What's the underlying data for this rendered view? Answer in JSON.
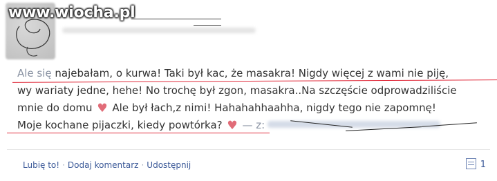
{
  "watermark": "www.wiocha.pl",
  "post": {
    "line1_muted": "Ale się",
    "line1_rest": " najebałam, o kurwa! Taki był kac, że masakra! Nigdy więcej z wami nie piję,",
    "line2": "wy wariaty jedne, hehe! No trochę był zgon, masakra..Na szczęście odprowadziliście",
    "line3a": "mnie do domu",
    "line3b": "Ale był łach,z nimi! Hahahahhaahha, nigdy tego nie zapomnę!",
    "line4": "Moje kochane pijaczki, kiedy powtórka?",
    "from_label": "— z:",
    "heart_glyph": "♥"
  },
  "actions": {
    "like": "Lubię to!",
    "comment": "Dodaj komentarz",
    "share": "Udostępnij",
    "separator": "·",
    "comment_count": "1"
  },
  "colors": {
    "link": "#3b5998",
    "heart": "#e16c78",
    "underline": "#e02a3a"
  }
}
